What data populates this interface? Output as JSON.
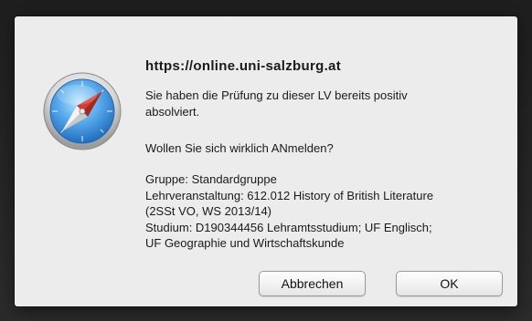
{
  "dialog": {
    "title": "https://online.uni-salzburg.at",
    "message_line1": "Sie haben die Prüfung zu dieser LV bereits positiv",
    "message_line2": "absolviert.",
    "question": "Wollen Sie sich wirklich ANmelden?",
    "details": [
      "Gruppe: Standardgruppe",
      "Lehrveranstaltung: 612.012 History of British Literature",
      "(2SSt VO, WS 2013/14)",
      "Studium: D190344456 Lehramtsstudium; UF Englisch;",
      "UF Geographie und Wirtschaftskunde"
    ],
    "app_icon": "safari-compass-icon"
  },
  "buttons": {
    "cancel_label": "Abbrechen",
    "ok_label": "OK"
  },
  "colors": {
    "dialog_bg": "#ececec",
    "compass_blue": "#3a8fd6",
    "needle_red": "#d93a2f"
  }
}
